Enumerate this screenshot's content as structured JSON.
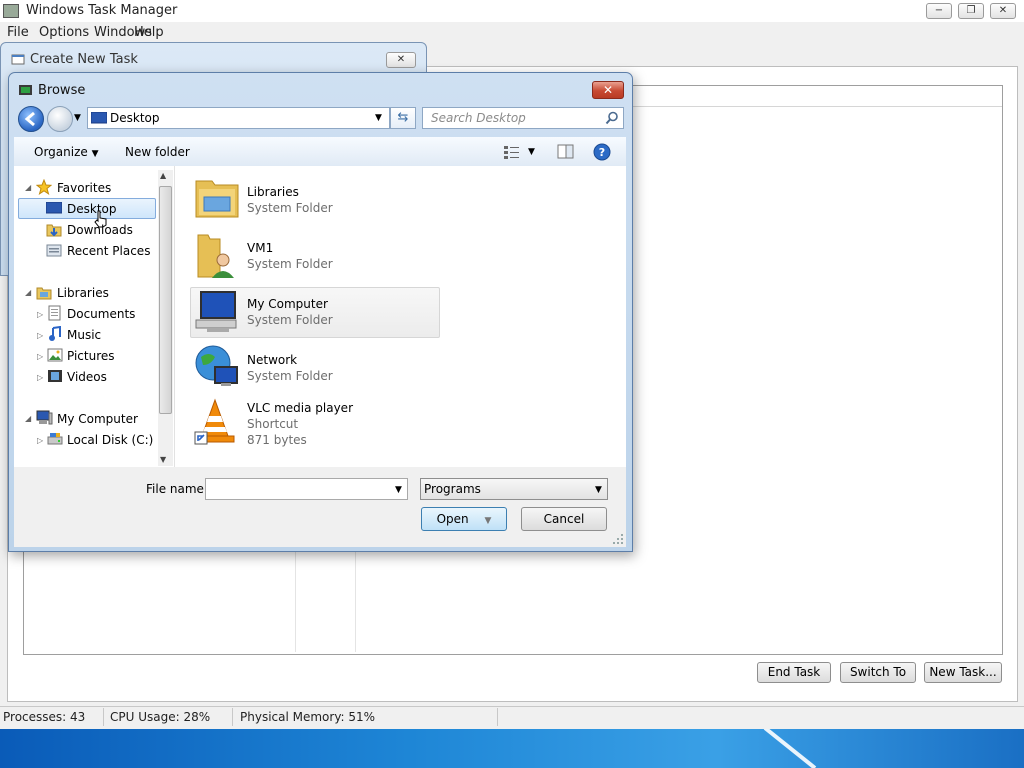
{
  "task_manager": {
    "title": "Windows Task Manager",
    "menu": [
      "File",
      "Options",
      "Windows",
      "Help"
    ],
    "caption_buttons": {
      "minimize": "−",
      "maximize": "❐",
      "close": "✕"
    },
    "buttons": {
      "end_task": "End Task",
      "switch_to": "Switch To",
      "new_task": "New Task..."
    },
    "status": {
      "processes": "Processes: 43",
      "cpu": "CPU Usage: 28%",
      "memory": "Physical Memory: 51%"
    }
  },
  "create_new_task": {
    "title": "Create New Task",
    "close": "✕"
  },
  "browse": {
    "title": "Browse",
    "close": "✕",
    "address": "Desktop",
    "search_placeholder": "Search Desktop",
    "toolbar": {
      "organize": "Organize",
      "new_folder": "New folder"
    },
    "nav": {
      "favorites": "Favorites",
      "favorites_items": [
        "Desktop",
        "Downloads",
        "Recent Places"
      ],
      "libraries": "Libraries",
      "libraries_items": [
        "Documents",
        "Music",
        "Pictures",
        "Videos"
      ],
      "computer": "My Computer",
      "computer_items": [
        "Local Disk (C:)"
      ]
    },
    "items": [
      {
        "name": "Libraries",
        "type": "System Folder",
        "icon": "libraries-folder-icon"
      },
      {
        "name": "VM1",
        "type": "System Folder",
        "icon": "user-folder-icon"
      },
      {
        "name": "My Computer",
        "type": "System Folder",
        "icon": "computer-icon"
      },
      {
        "name": "Network",
        "type": "System Folder",
        "icon": "network-icon"
      },
      {
        "name": "VLC media player",
        "type": "Shortcut",
        "size": "871 bytes",
        "icon": "vlc-icon"
      }
    ],
    "file_name_label": "File name:",
    "file_name_value": "",
    "file_type": "Programs",
    "open": "Open",
    "cancel": "Cancel"
  },
  "colors": {
    "title_bar": "#cfe0f2",
    "selection": "#cfe6fb",
    "close_red": "#c84a33",
    "desktop_blue": "#1a6fc4"
  }
}
